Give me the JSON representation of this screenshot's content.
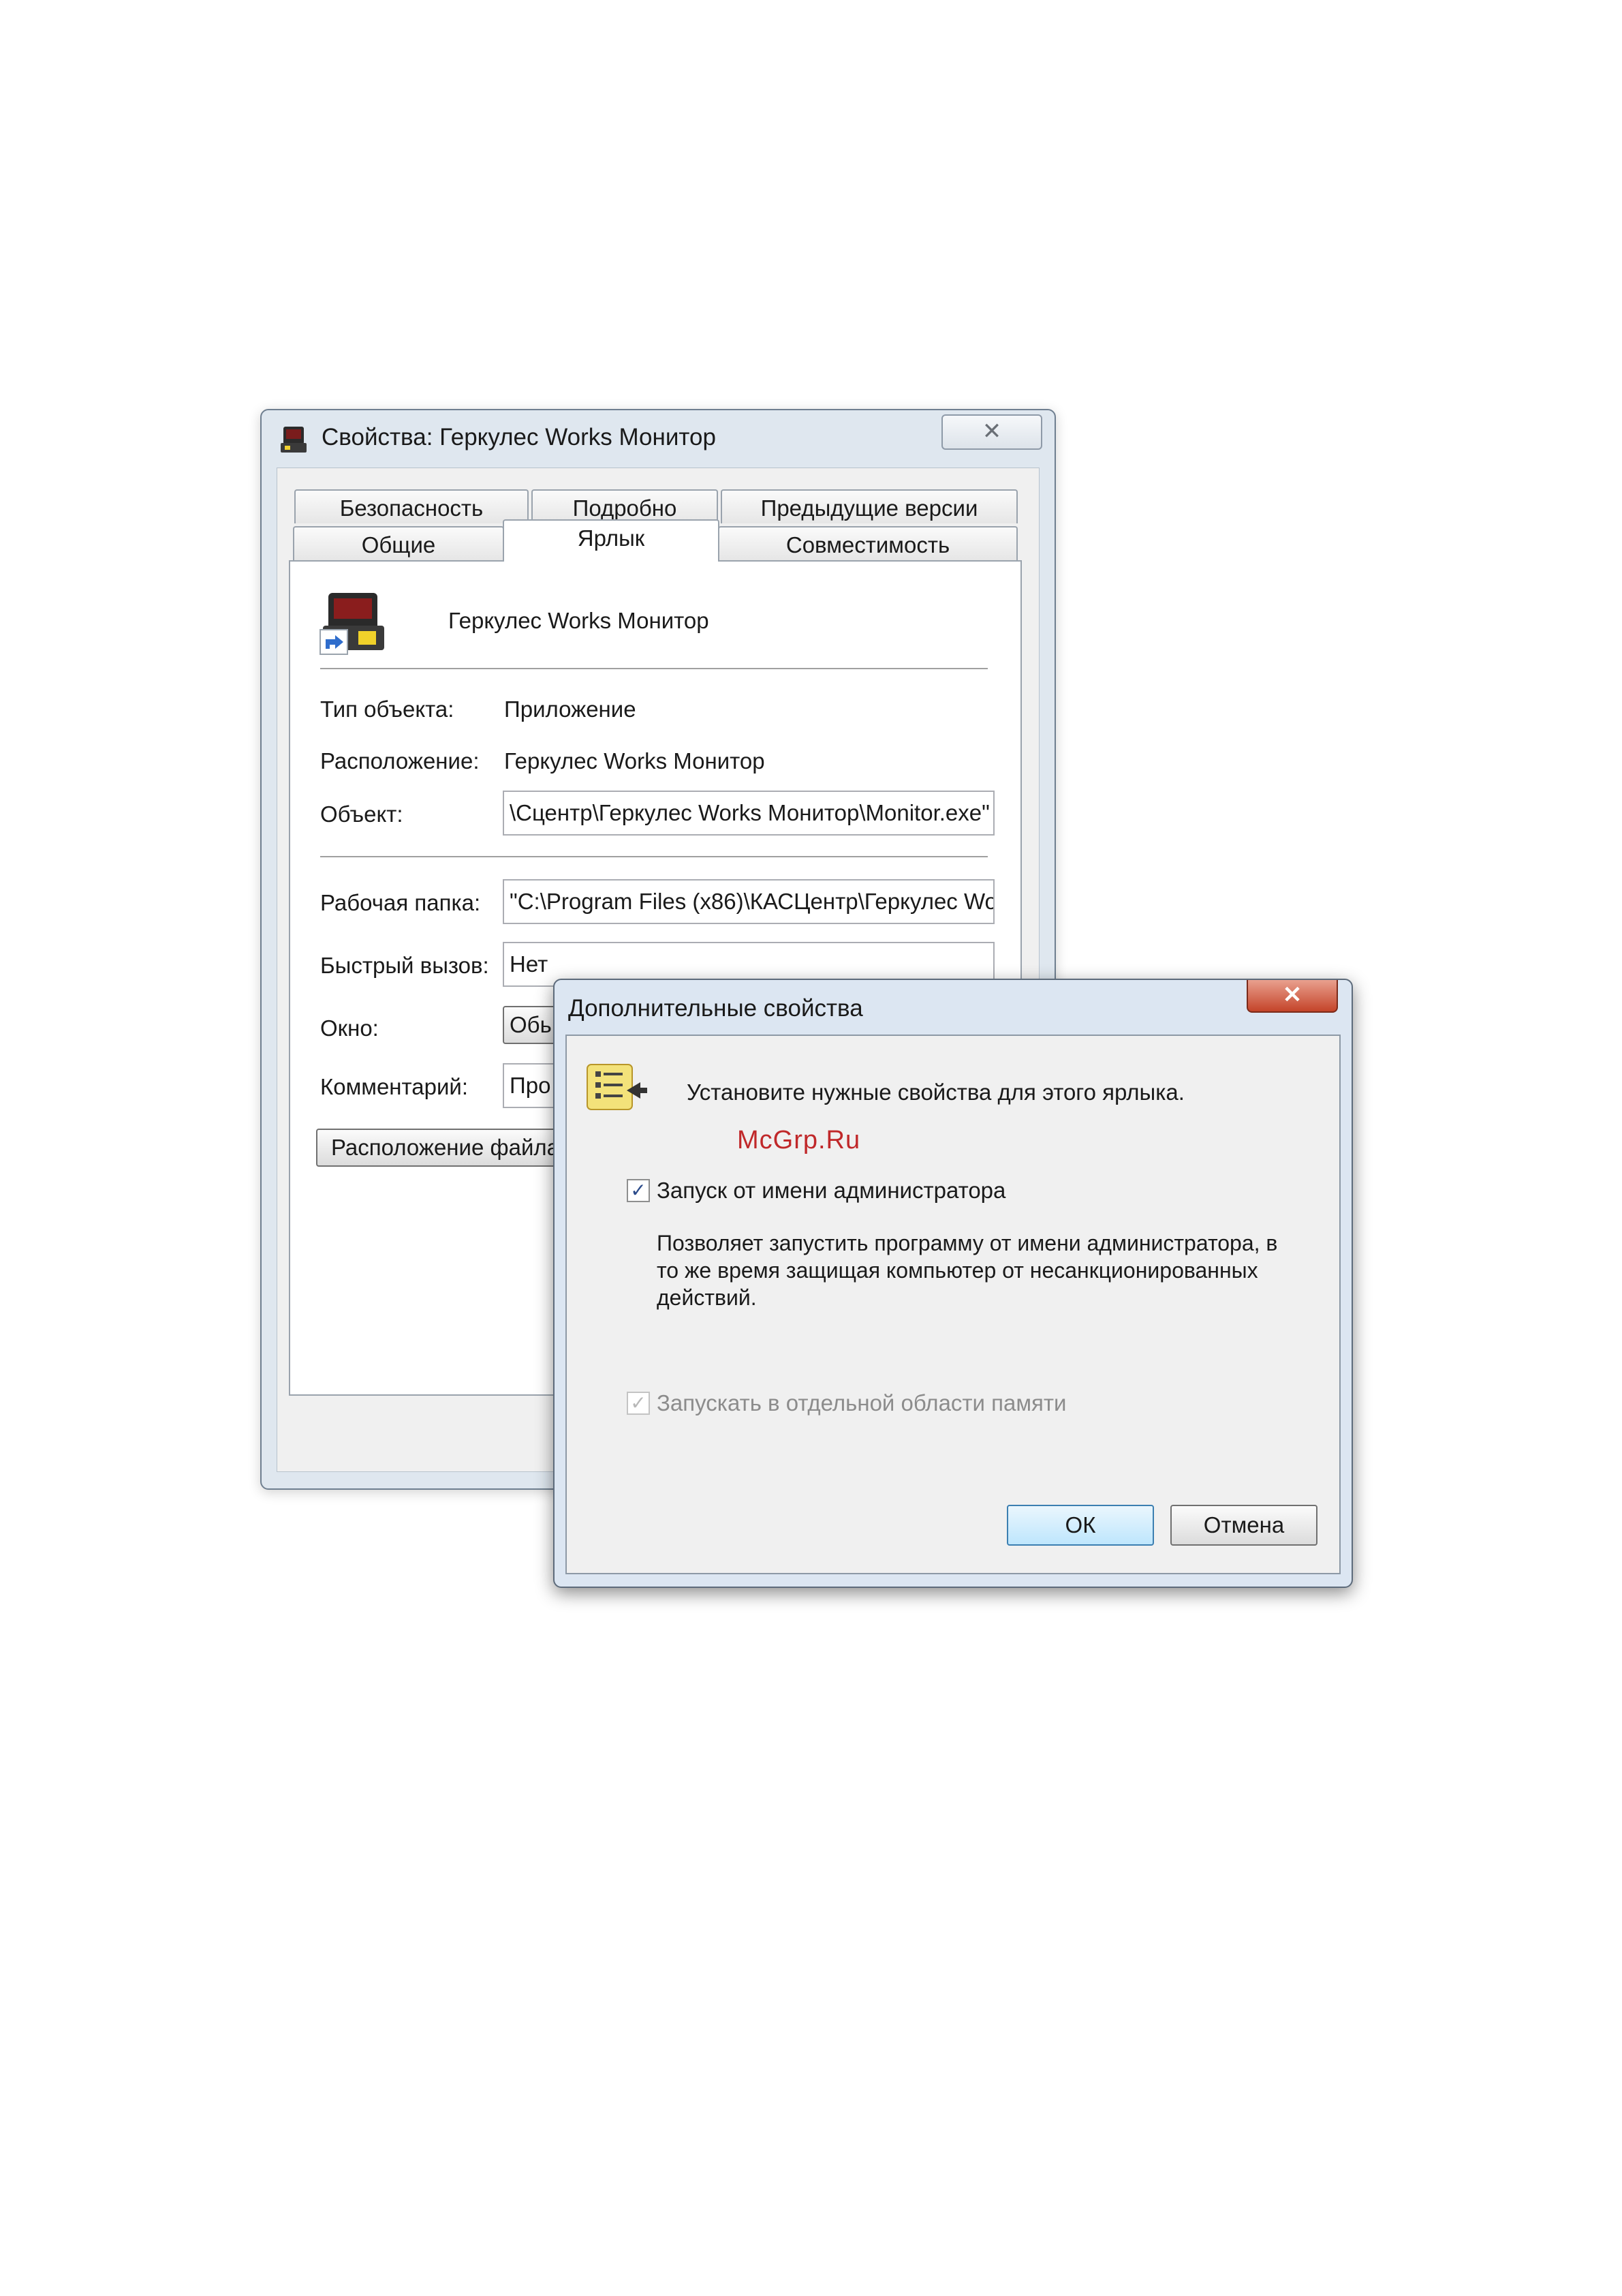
{
  "properties_window": {
    "title": "Свойства: Геркулес Works Монитор",
    "close_glyph": "✕",
    "tabs_row_back": [
      "Безопасность",
      "Подробно",
      "Предыдущие версии"
    ],
    "tabs_row_front": [
      "Общие",
      "Ярлык",
      "Совместимость"
    ],
    "active_tab": "Ярлык",
    "shortcut_name": "Геркулес Works Монитор",
    "fields": {
      "type_label": "Тип объекта:",
      "type_value": "Приложение",
      "location_label": "Расположение:",
      "location_value": "Геркулес Works Монитор",
      "target_label": "Объект:",
      "target_value": "\\Сцентр\\Геркулес Works Монитор\\Monitor.exe\"",
      "startin_label": "Рабочая папка:",
      "startin_value": "\"C:\\Program Files (x86)\\КАСЦентр\\Геркулес Wo",
      "hotkey_label": "Быстрый вызов:",
      "hotkey_value": "Нет",
      "run_label": "Окно:",
      "run_value": "Обь",
      "comment_label": "Комментарий:",
      "comment_value": "Про"
    },
    "open_location_button": "Расположение файла"
  },
  "advanced_dialog": {
    "title": "Дополнительные свойства",
    "close_glyph": "✕",
    "instruction": "Установите нужные свойства для этого ярлыка.",
    "watermark": "McGrp.Ru",
    "run_as_admin_label": "Запуск от имени администратора",
    "run_as_admin_checked": true,
    "description_lines": [
      "Позволяет запустить программу от имени администратора, в",
      "то же время защищая компьютер от несанкционированных",
      "действий."
    ],
    "separate_memory_label": "Запускать в отдельной области памяти",
    "separate_memory_checked": true,
    "separate_memory_disabled": true,
    "ok_button": "ОК",
    "cancel_button": "Отмена"
  },
  "icons": {
    "app_icon": "hercules-works-app-icon",
    "shortcut_overlay": "shortcut-arrow-icon",
    "properties_icon": "properties-list-icon",
    "checkmark": "✓"
  },
  "colors": {
    "window_frame": "#dfe7ef",
    "dialog_frame": "#dce6f2",
    "close_red": "#c4442a",
    "watermark_red": "#c0282a"
  }
}
